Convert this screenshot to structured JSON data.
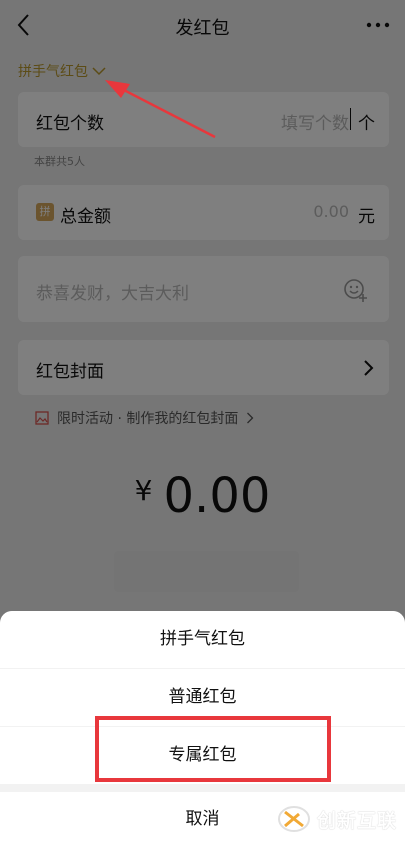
{
  "nav": {
    "title": "发红包"
  },
  "packet_type": {
    "label": "拼手气红包"
  },
  "count_row": {
    "label": "红包个数",
    "placeholder": "填写个数",
    "unit": "个",
    "note": "本群共5人"
  },
  "amount_row": {
    "badge": "拼",
    "label": "总金额",
    "value": "0.00",
    "unit": "元"
  },
  "greeting": {
    "placeholder": "恭喜发财，大吉大利"
  },
  "cover_row": {
    "label": "红包封面"
  },
  "promo": {
    "text": "限时活动 · 制作我的红包封面"
  },
  "total": {
    "currency": "¥",
    "amount": "0.00"
  },
  "sheet": {
    "options": [
      "拼手气红包",
      "普通红包",
      "专属红包"
    ],
    "cancel": "取消"
  },
  "watermark": {
    "text": "创新互联"
  },
  "colors": {
    "accent_gold": "#b9982d",
    "highlight_red": "#e8373c",
    "annotation_red": "#e8373c"
  },
  "icons": {
    "back": "chevron-left-icon",
    "more": "more-dots-icon",
    "emoji": "emoji-add-icon",
    "cover_chevron": "chevron-right-icon"
  }
}
